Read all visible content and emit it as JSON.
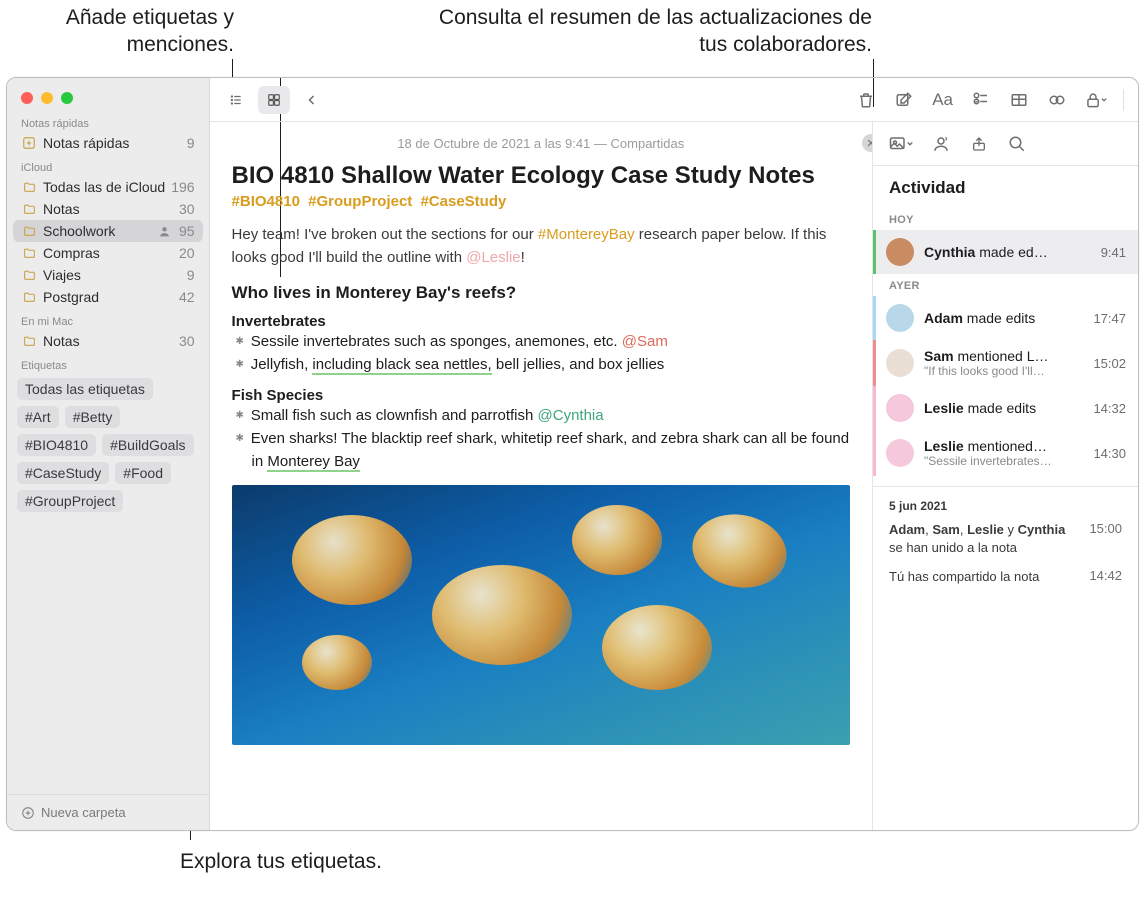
{
  "callouts": {
    "top_left": "Añade etiquetas y menciones.",
    "top_right": "Consulta el resumen de las actualizaciones de tus colaboradores.",
    "bottom": "Explora tus etiquetas."
  },
  "sidebar": {
    "quick_notes_header": "Notas rápidas",
    "quick_notes": {
      "label": "Notas rápidas",
      "count": "9"
    },
    "icloud_header": "iCloud",
    "icloud_folders": [
      {
        "label": "Todas las de iCloud",
        "count": "196",
        "shared": false
      },
      {
        "label": "Notas",
        "count": "30",
        "shared": false
      },
      {
        "label": "Schoolwork",
        "count": "95",
        "shared": true,
        "selected": true
      },
      {
        "label": "Compras",
        "count": "20",
        "shared": false
      },
      {
        "label": "Viajes",
        "count": "9",
        "shared": false
      },
      {
        "label": "Postgrad",
        "count": "42",
        "shared": false
      }
    ],
    "onmymac_header": "En mi Mac",
    "onmymac_folders": [
      {
        "label": "Notas",
        "count": "30"
      }
    ],
    "tags_header": "Etiquetas",
    "tags": [
      "Todas las etiquetas",
      "#Art",
      "#Betty",
      "#BIO4810",
      "#BuildGoals",
      "#CaseStudy",
      "#Food",
      "#GroupProject"
    ],
    "new_folder": "Nueva carpeta"
  },
  "toolbar": {
    "icons": {
      "list_view": "list-view-icon",
      "gallery_view": "gallery-view-icon",
      "back": "chevron-left-icon",
      "trash": "trash-icon",
      "compose": "compose-icon",
      "format": "format-icon",
      "checklist": "checklist-icon",
      "table": "table-icon",
      "link": "link-icon",
      "lock": "lock-icon",
      "media": "media-icon",
      "collaborate": "collaborate-icon",
      "share": "share-icon",
      "search": "search-icon"
    },
    "format_label": "Aa"
  },
  "note": {
    "meta": "18 de Octubre de 2021 a las 9:41 — Compartidas",
    "title": "BIO 4810 Shallow Water Ecology Case Study Notes",
    "tags": [
      "#BIO4810",
      "#GroupProject",
      "#CaseStudy"
    ],
    "intro_a": "Hey team! I've broken out the sections for our ",
    "intro_tag": "#MontereyBay",
    "intro_b": " research paper below. If this looks good I'll build the outline with ",
    "intro_mention": "@Leslie",
    "intro_c": "!",
    "heading": "Who lives in Monterey Bay's reefs?",
    "invert_title": "Invertebrates",
    "invert_items": [
      {
        "pre": "Sessile invertebrates such as sponges, anemones, etc. ",
        "assign": "@Sam"
      },
      {
        "pre": "Jellyfish, ",
        "hl": "including black sea nettles,",
        "post": " bell jellies, and box jellies"
      }
    ],
    "fish_title": "Fish Species",
    "fish_items": [
      {
        "pre": "Small fish such as clownfish and parrotfish ",
        "assign": "@Cynthia"
      },
      {
        "pre": "Even sharks! The blacktip reef shark, whitetip reef shark, and zebra shark can all be found in ",
        "hl": "Monterey Bay"
      }
    ]
  },
  "activity": {
    "title": "Actividad",
    "today": "HOY",
    "yesterday": "AYER",
    "today_items": [
      {
        "name": "Cynthia",
        "action": " made ed…",
        "time": "9:41",
        "color": "green",
        "avatar_bg": "#c98b61"
      }
    ],
    "yesterday_items": [
      {
        "name": "Adam",
        "action": " made edits",
        "time": "17:47",
        "bar": "blue",
        "avatar_bg": "#b8d8ea"
      },
      {
        "name": "Sam",
        "action": " mentioned L…",
        "sub": "\"If this looks good I'll…",
        "time": "15:02",
        "bar": "red",
        "avatar_bg": "#e9dfd4"
      },
      {
        "name": "Leslie",
        "action": " made edits",
        "time": "14:32",
        "bar": "pink",
        "avatar_bg": "#f5c9db"
      },
      {
        "name": "Leslie",
        "action": " mentioned…",
        "sub": "\"Sessile invertebrates…",
        "time": "14:30",
        "bar": "pink",
        "avatar_bg": "#f5c9db"
      }
    ],
    "older_date": "5 jun 2021",
    "older_items": [
      {
        "text": "Adam, Sam, Leslie y Cynthia se han unido a la nota",
        "time": "15:00"
      },
      {
        "text": "Tú has compartido la nota",
        "time": "14:42"
      }
    ]
  }
}
